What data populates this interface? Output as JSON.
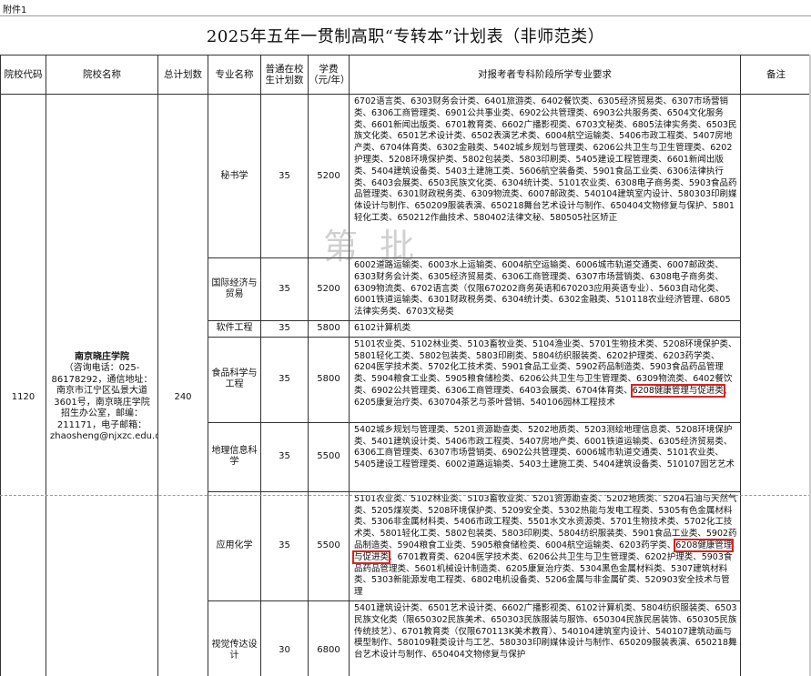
{
  "attachment": "附件1",
  "title": "2025年五年一贯制高职“专转本”计划表（非师范类）",
  "headers": {
    "code": "院校代码",
    "school": "院校名称",
    "total": "总计划数",
    "major": "专业名称",
    "plan": "普通在校生计划数",
    "fee": "学费（元/年）",
    "req": "对报考者专科阶段所学专业要求",
    "note": "备注"
  },
  "school": {
    "code": "1120",
    "name": "南京晓庄学院",
    "info": "（咨询电话：025-86178292，通信地址：南京市江宁区弘景大道3601号，南京晓庄学院招生办公室，邮编：211171，电子邮箱：zhaosheng@njxzc.edu.cn）",
    "total": "240"
  },
  "rows": [
    {
      "major": "秘书学",
      "plan": "35",
      "fee": "5200",
      "req": "6702语言类、6303财务会计类、6401旅游类、6402餐饮类、6305经济贸易类、6307市场营销类、6306工商管理类、6901公共事业类、6902公共管理类、6903公共服务类、6504文化服务类、6601新闻出版类、6701教育类、6602广播影视类、6703文秘类、6805法律实务类、6503民族文化类、6501艺术设计类、6502表演艺术类、6004航空运输类、5406市政工程类、5407房地产类、6704体育类、6302金融类、5402城乡规划与管理类、6206公共卫生与卫生管理类、6202护理类、5208环境保护类、5802包装类、5803印刷类、5405建设工程管理类、6601新闻出版类、5404建筑设备类、5403土建施工类、5606航空装备类、5901食品工业类、6306法律执行类、6403会展类、6503民族文化类、6304统计类、5101农业类、6308电子商务类、5903食品药品管理类、6301财政税务类、6309物流类、6007邮政类、540104建筑室内设计、580303印刷媒体设计与制作、650209服装表演、650218舞台艺术设计与制作、650404文物修复与保护、5801轻化工类、650212作曲技术、580402法律文秘、580505社区矫正"
    },
    {
      "major": "国际经济与贸易",
      "plan": "35",
      "fee": "5200",
      "req": "6002道路运输类、6003水上运输类、6004航空运输类、6006城市轨道交通类、6007邮政类、6303财务会计类、6305经济贸易类、6306工商管理类、6307市场营销类、6308电子商务类、6309物流类、6702语言类（仅限670202商务英语和670203应用英语专业）、5603自动化类、6001铁道运输类、6301财政税务类、6304统计类、6302金融类、510118农业经济管理、6805法律实务类、6703文秘类"
    },
    {
      "major": "软件工程",
      "plan": "35",
      "fee": "5800",
      "req": "6102计算机类"
    },
    {
      "major": "食品科学与工程",
      "plan": "35",
      "fee": "5800",
      "req_a": "5101农业类、5102林业类、5103畜牧业类、5104渔业类、5701生物技术类、5208环境保护类、5801轻化工类、5802包装类、5803印刷类、5804纺织服装类、6202护理类、6203药学类、6204医学技术类、5702化工技术类、5901食品工业类、5902药品制造类、5903食品药品管理类、5904粮食工业类、5905粮食储检类、6206公共卫生与卫生管理类、6309物流类、6402餐饮类、6902公共管理类、6306工商管理类、6403会展类、6704体育类、",
      "req_mark": "6208健康管理与促进类",
      "req_b": "、6205康复治疗类、630704茶艺与茶叶营销、540106园林工程技术"
    },
    {
      "major": "地理信息科学",
      "plan": "35",
      "fee": "5500",
      "req": "5402城乡规划与管理类、5201资源勘查类、5202地质类、5203测绘地理信息类、5208环境保护类、5401建筑设计类、5406市政工程类、5407房地产类、6001铁道运输类、6305经济贸易类、6306工商管理类、6307市场营销类、6902公共管理类、6006城市轨道交通类、5101农业类、5405建设工程管理类、6002道路运输类、5403土建施工类、5404建筑设备类、510107园艺艺术"
    },
    {
      "major": "应用化学",
      "plan": "35",
      "fee": "5500",
      "req_a": "5101农业类、5102林业类、5103畜牧业类、5201资源勘查类、5202地质类、5204石油与天然气类、5205煤炭类、5208环境保护类、5209安全类、5302热能与发电工程类、5305有色金属材料类、5306非金属材料类、5406市政工程类、5501水文水资源类、5701生物技术类、5702化工技术类、5801轻化工类、5802包装类、5803印刷类、5804纺织服装类、5901食品工业类、5902药品制造类、5904粮食工业类、5905粮食储检类、6004航空运输类、6203药学类、",
      "req_mark": "6208健康管理与促进类",
      "req_b": "、6701教育类、6204医学技术类、6206公共卫生与卫生管理类、6202护理类、5903食品药品管理类、5601机械设计制造类、6205康复治疗类、5304黑色金属材料类、5307建筑材料类、5303新能源发电工程类、6802电机设备类、5206金属与非金属矿类、520903安全技术与管理"
    },
    {
      "major": "视觉传达设计",
      "plan": "30",
      "fee": "6800",
      "req": "5401建筑设计类、6501艺术设计类、6602广播影视类、6102计算机类、5804纺织服装类、6503民族文化类（限650302民族美术、650303民族服装与服饰、650304民族民居装饰、650305民族传统技艺）、6701教育类（仅限670113K美术教育）、540104建筑室内设计、540107建筑动画与模型制作、580109鞋类设计与工艺、580303印刷媒体设计与制作、650209服装表演、650218舞台艺术设计与制作、650404文物修复与保护"
    }
  ],
  "watermark": "第 批"
}
